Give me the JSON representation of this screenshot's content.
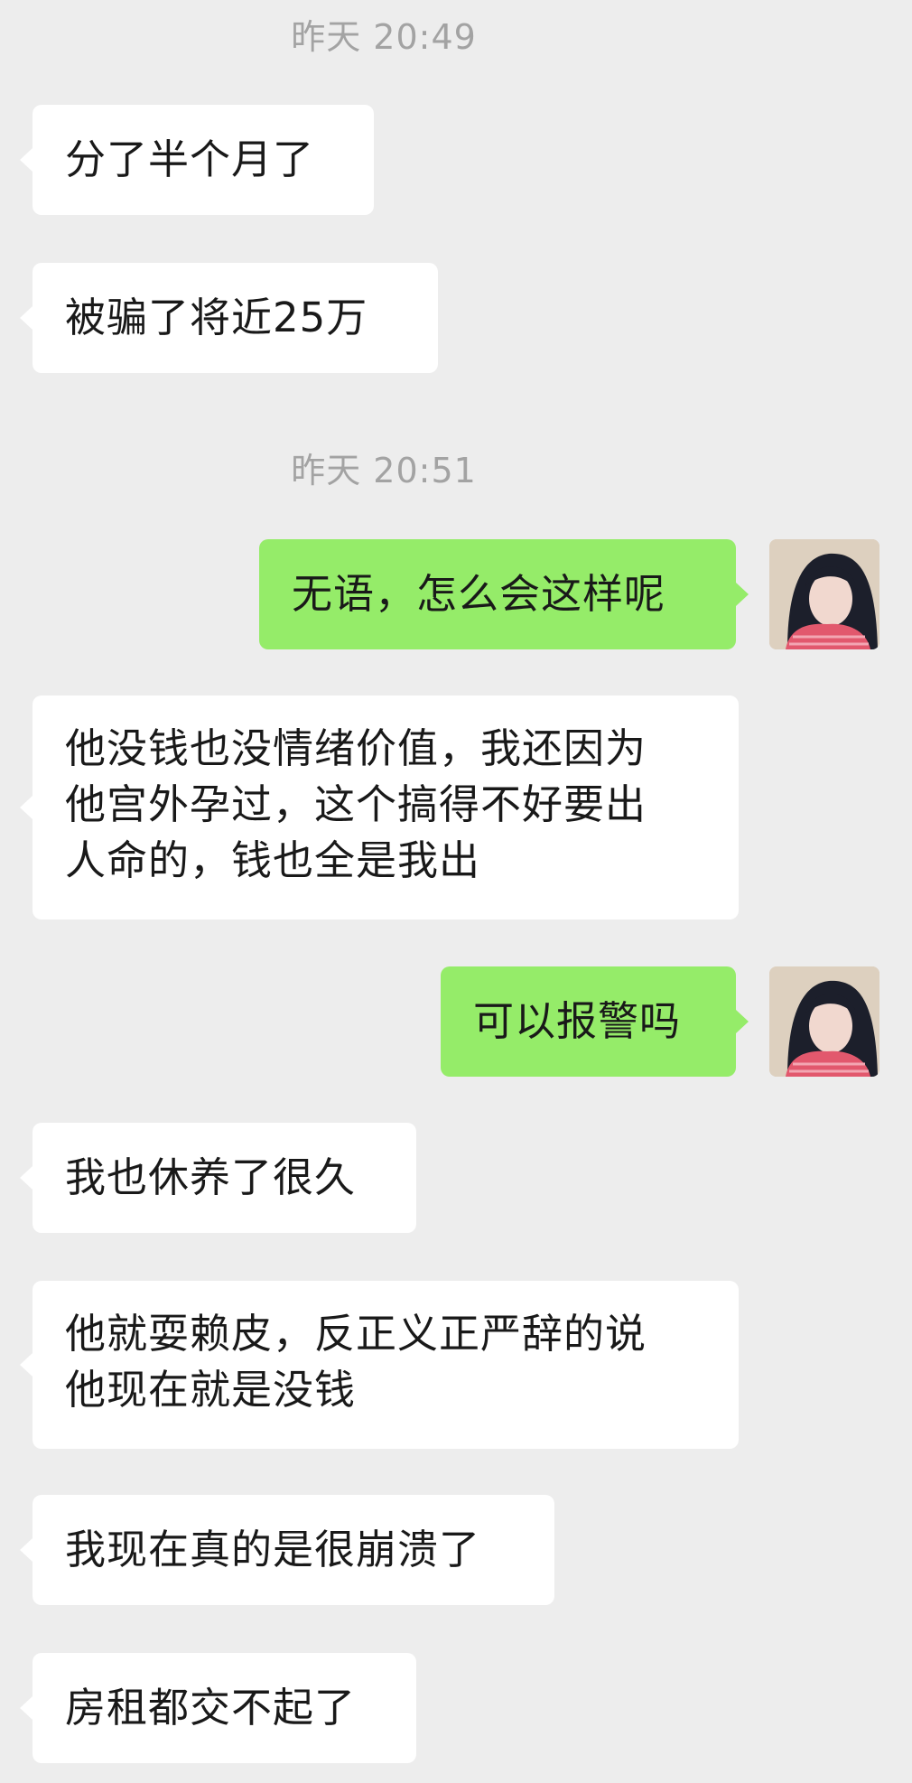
{
  "chat": {
    "timestamps": [
      "昨天 20:49",
      "昨天 20:51"
    ],
    "messages": [
      {
        "text": "分了半个月了"
      },
      {
        "text": "被骗了将近25万"
      },
      {
        "text": "无语，怎么会这样呢"
      },
      {
        "text": "他没钱也没情绪价值，我还因为\n他宫外孕过，这个搞得不好要出\n人命的，钱也全是我出"
      },
      {
        "text": "可以报警吗"
      },
      {
        "text": "我也休养了很久"
      },
      {
        "text": "他就耍赖皮，反正义正严辞的说\n他现在就是没钱"
      },
      {
        "text": "我现在真的是很崩溃了"
      },
      {
        "text": "房租都交不起了"
      }
    ],
    "avatar_icon": "user-avatar-photo",
    "colors": {
      "background": "#ededed",
      "incoming_bubble": "#ffffff",
      "outgoing_bubble": "#95ec69",
      "timestamp_text": "#a3a3a3",
      "message_text": "#191919"
    }
  }
}
